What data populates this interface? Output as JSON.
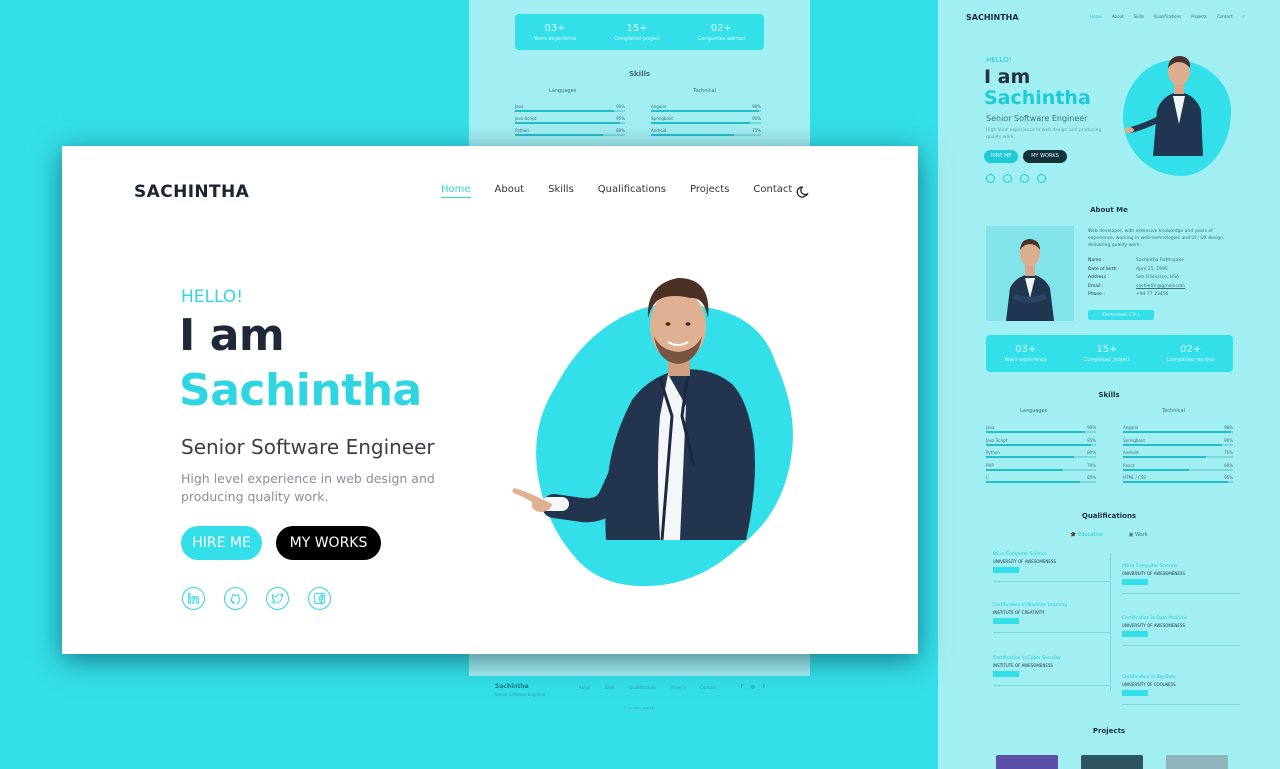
{
  "colors": {
    "accent": "#2fd6e2",
    "background": "#33dfe9",
    "dark": "#1e2838",
    "button_dark": "#000000"
  },
  "main": {
    "brand": "SACHINTHA",
    "nav": [
      "Home",
      "About",
      "Skills",
      "Qualifications",
      "Projects",
      "Contact"
    ],
    "active_nav": "Home",
    "theme_icon": "moon-icon",
    "hello": "HELLO!",
    "line1": "I am",
    "line2": "Sachintha",
    "role": "Senior Software Engineer",
    "description": "High level experience in web design and  producing quality work.",
    "hire_label": "HIRE ME",
    "works_label": "MY WORKS",
    "socials": [
      "linkedin-icon",
      "github-icon",
      "twitter-icon",
      "facebook-icon"
    ]
  },
  "bg_page": {
    "stats": [
      {
        "num": "03+",
        "label": "Years experience"
      },
      {
        "num": "15+",
        "label": "Completed project"
      },
      {
        "num": "02+",
        "label": "Companies worked"
      }
    ],
    "skills_title": "Skills",
    "col_languages": "Languages",
    "col_technical": "Technical",
    "languages": [
      {
        "name": "Java",
        "pct": "90%",
        "value": 0.9
      },
      {
        "name": "Java Script",
        "pct": "95%",
        "value": 0.95
      },
      {
        "name": "Python",
        "pct": "80%",
        "value": 0.8
      }
    ],
    "technical": [
      {
        "name": "Angular",
        "pct": "98%",
        "value": 0.98
      },
      {
        "name": "Springboot",
        "pct": "90%",
        "value": 0.9
      },
      {
        "name": "Android",
        "pct": "75%",
        "value": 0.75
      }
    ],
    "footer_brand": "Sachintha",
    "footer_sub": "Senior Software Engineer",
    "footer_links": [
      "About",
      "Skills",
      "Qualifications",
      "Projects",
      "Contact"
    ],
    "footer_copy": "©  All rights reserved"
  },
  "side": {
    "brand": "SACHINTHA",
    "nav": [
      "Home",
      "About",
      "Skills",
      "Qualifications",
      "Projects",
      "Contact"
    ],
    "hello": "HELLO!",
    "line1": "I am",
    "line2": "Sachintha",
    "role": "Senior Software Engineer",
    "description": "High level experience in web design and  producing quality work.",
    "hire_label": "HIRE ME",
    "works_label": "MY WORKS",
    "about_title": "About Me",
    "about_text": "Web developer, with extensive knowledge and years of experience, working in web technologies and UI / UX design, delivering quality work.",
    "info_labels": [
      "Name :",
      "Date of birth :",
      "Address :",
      "Email :",
      "Phone :"
    ],
    "info_values": [
      "Sachintha Rathnyake",
      "April 21, 1995",
      "San Francisco, USA",
      "sachinthr@gmail.com",
      "+94 77 23456"
    ],
    "cv_label": "Download CV",
    "stats": [
      {
        "num": "03+",
        "label": "Years experience"
      },
      {
        "num": "15+",
        "label": "Completed project"
      },
      {
        "num": "02+",
        "label": "Companies worked"
      }
    ],
    "skills_title": "Skills",
    "col_languages": "Languages",
    "col_technical": "Technical",
    "languages": [
      {
        "name": "Java",
        "pct": "90%",
        "value": 0.9
      },
      {
        "name": "Java Script",
        "pct": "95%",
        "value": 0.95
      },
      {
        "name": "Python",
        "pct": "80%",
        "value": 0.8
      },
      {
        "name": "PHP",
        "pct": "70%",
        "value": 0.7
      },
      {
        "name": "C",
        "pct": "85%",
        "value": 0.85
      }
    ],
    "technical": [
      {
        "name": "Angular",
        "pct": "98%",
        "value": 0.98
      },
      {
        "name": "Springboot",
        "pct": "90%",
        "value": 0.9
      },
      {
        "name": "Android",
        "pct": "75%",
        "value": 0.75
      },
      {
        "name": "React",
        "pct": "60%",
        "value": 0.6
      },
      {
        "name": "HTML / CSS",
        "pct": "95%",
        "value": 0.95
      }
    ],
    "qual_title": "Qualifications",
    "tab_education": "Education",
    "tab_work": "Work",
    "qual_left": [
      {
        "title": "BS in Computer Science",
        "sub": "UNIVERSITY OF AWESOMENESS"
      },
      {
        "title": "Certification in Machine Learning",
        "sub": "INSTITUTE OF CREATIVITY"
      },
      {
        "title": "Certification in Cyber Security",
        "sub": "INSTITUTE OF AWESOMENESS"
      }
    ],
    "qual_right": [
      {
        "title": "MS in Computer Science",
        "sub": "UNIVERSITY OF AWESOMENESS"
      },
      {
        "title": "Certification in Data Analysis",
        "sub": "UNIVERSITY OF AWESOMENESS"
      },
      {
        "title": "Certification in Big Data",
        "sub": "UNIVERSITY OF COOLNESS"
      }
    ],
    "projects_title": "Projects"
  }
}
